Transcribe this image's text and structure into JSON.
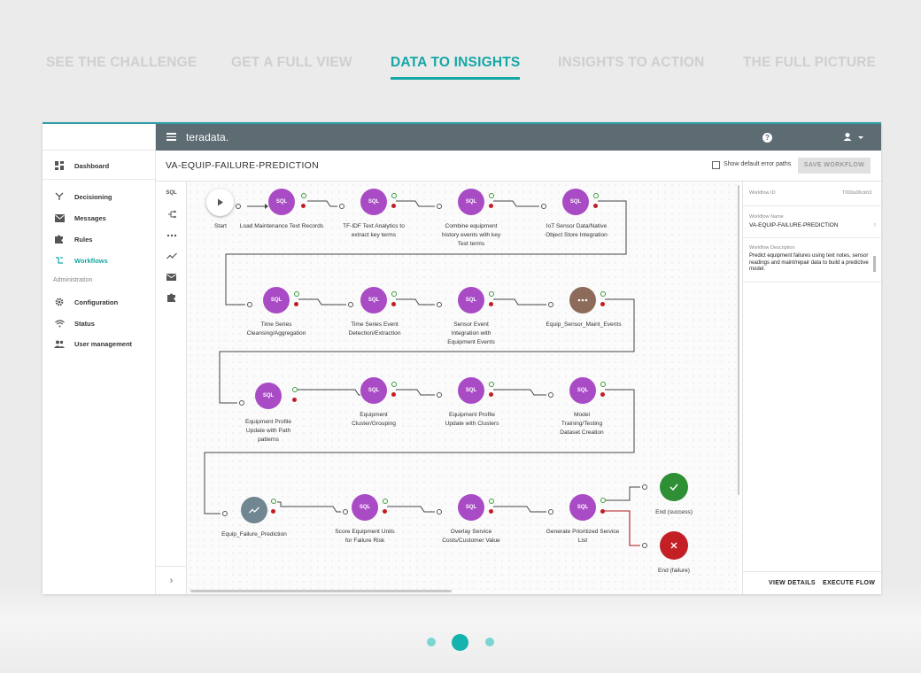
{
  "story_tabs": [
    {
      "label": "SEE THE CHALLENGE",
      "active": false
    },
    {
      "label": "GET A FULL VIEW",
      "active": false
    },
    {
      "label": "DATA TO INSIGHTS",
      "active": true
    },
    {
      "label": "INSIGHTS TO ACTION",
      "active": false
    },
    {
      "label": "THE FULL PICTURE",
      "active": false
    }
  ],
  "header": {
    "brand": "teradata.",
    "help_icon": "help-icon",
    "user_icon": "user-icon"
  },
  "sidebar": {
    "items": [
      {
        "label": "Dashboard",
        "icon": "dashboard-icon"
      },
      {
        "label": "Decisioning",
        "icon": "decisioning-icon"
      },
      {
        "label": "Messages",
        "icon": "mail-icon"
      },
      {
        "label": "Rules",
        "icon": "puzzle-icon"
      },
      {
        "label": "Workflows",
        "icon": "workflow-icon",
        "active": true
      },
      {
        "label": "Configuration",
        "icon": "gear-icon"
      },
      {
        "label": "Status",
        "icon": "wifi-icon"
      },
      {
        "label": "User management",
        "icon": "users-icon"
      }
    ],
    "section_admin": "Administration"
  },
  "workflow": {
    "title": "VA-EQUIP-FAILURE-PREDICTION",
    "show_error_paths_label": "Show default error paths",
    "save_label": "SAVE WORKFLOW"
  },
  "palette": {
    "sql_label": "SQL"
  },
  "nodes": {
    "sql_text": "SQL",
    "start": "Start",
    "n1": "Load Maintenance Text Records",
    "n2": "TF-IDF Text Analytics to extract key terms",
    "n3": "Combine equipment history events with key Text terms",
    "n4": "IoT Sensor Data/Native Object Store Integration",
    "n5": "Time Series Cleansing/Aggregation",
    "n6": "Time Series Event Detection/Extraction",
    "n7": "Sensor Event Integration with Equipment Events",
    "n8": "Equip_Sensor_Maint_Events",
    "n9": "Equipment Profile Update with Path patterns",
    "n10": "Equipment Cluster/Grouping",
    "n11": "Equipment Profile Update with Clusters",
    "n12": "Model Training/Testing Dataset Creation",
    "n13": "Equip_Failure_Prediction",
    "n14": "Score Equipment Units for Failure Risk",
    "n15": "Overlay Service Costs/Customer Value",
    "n16": "Generate Prioritized Service List",
    "end_success": "End (success)",
    "end_failure": "End (failure)"
  },
  "properties": {
    "id_key": "Workflow ID",
    "id_val": "T000a96ckh3",
    "name_key": "Workflow Name",
    "name_val": "VA-EQUIP-FAILURE-PREDICTION",
    "desc_key": "Workflow Description",
    "desc_val": "Predict equipment failures using text notes, sensor readings and maint/repair data to build a predictive model.",
    "view_details": "VIEW DETAILS",
    "execute_flow": "EXECUTE FLOW"
  },
  "pager": {
    "pages": 3,
    "current": 2
  },
  "colors": {
    "accent": "#14a7a4",
    "sql_node": "#a94bc5",
    "success": "#2f8f35",
    "failure": "#c51f26"
  }
}
